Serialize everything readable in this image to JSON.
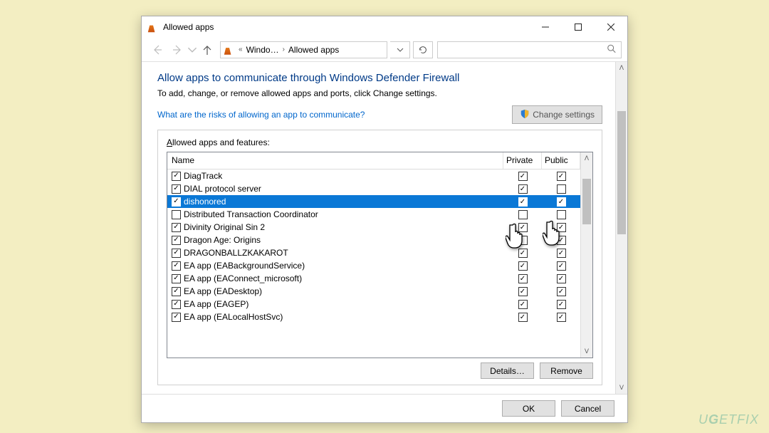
{
  "window": {
    "title": "Allowed apps"
  },
  "breadcrumb": {
    "prefix": "«",
    "item1": "Windo…",
    "item2": "Allowed apps"
  },
  "page": {
    "heading": "Allow apps to communicate through Windows Defender Firewall",
    "subtext": "To add, change, or remove allowed apps and ports, click Change settings.",
    "risks_link": "What are the risks of allowing an app to communicate?",
    "change_settings_label": "Change settings"
  },
  "group": {
    "label_prefix": "A",
    "label_rest": "llowed apps and features:"
  },
  "table": {
    "col_name": "Name",
    "col_private": "Private",
    "col_public": "Public",
    "rows": [
      {
        "name": "DiagTrack",
        "checked": true,
        "private": true,
        "public": true,
        "selected": false
      },
      {
        "name": "DIAL protocol server",
        "checked": true,
        "private": true,
        "public": false,
        "selected": false
      },
      {
        "name": "dishonored",
        "checked": true,
        "private": true,
        "public": true,
        "selected": true
      },
      {
        "name": "Distributed Transaction Coordinator",
        "checked": false,
        "private": false,
        "public": false,
        "selected": false
      },
      {
        "name": "Divinity Original Sin 2",
        "checked": true,
        "private": true,
        "public": true,
        "selected": false
      },
      {
        "name": "Dragon Age: Origins",
        "checked": true,
        "private": false,
        "public": true,
        "selected": false
      },
      {
        "name": "DRAGONBALLZKAKAROT",
        "checked": true,
        "private": true,
        "public": true,
        "selected": false
      },
      {
        "name": "EA app (EABackgroundService)",
        "checked": true,
        "private": true,
        "public": true,
        "selected": false
      },
      {
        "name": "EA app (EAConnect_microsoft)",
        "checked": true,
        "private": true,
        "public": true,
        "selected": false
      },
      {
        "name": "EA app (EADesktop)",
        "checked": true,
        "private": true,
        "public": true,
        "selected": false
      },
      {
        "name": "EA app (EAGEP)",
        "checked": true,
        "private": true,
        "public": true,
        "selected": false
      },
      {
        "name": "EA app (EALocalHostSvc)",
        "checked": true,
        "private": true,
        "public": true,
        "selected": false
      }
    ]
  },
  "buttons": {
    "details": "Details…",
    "remove": "Remove",
    "ok": "OK",
    "cancel": "Cancel"
  },
  "watermark": "UGETFIX"
}
